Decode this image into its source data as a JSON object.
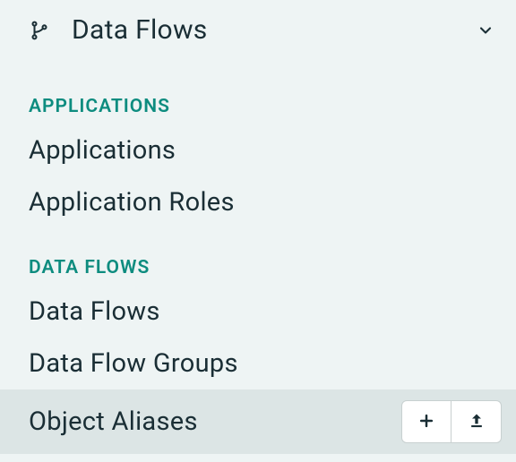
{
  "header": {
    "title": "Data Flows"
  },
  "sections": [
    {
      "label": "APPLICATIONS",
      "items": [
        {
          "label": "Applications"
        },
        {
          "label": "Application Roles"
        }
      ]
    },
    {
      "label": "DATA FLOWS",
      "items": [
        {
          "label": "Data Flows"
        },
        {
          "label": "Data Flow Groups"
        },
        {
          "label": "Object Aliases"
        }
      ]
    }
  ]
}
